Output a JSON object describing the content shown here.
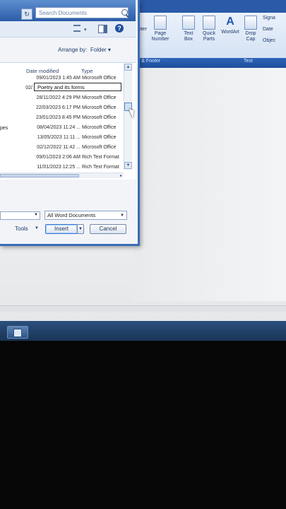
{
  "search": {
    "placeholder": "Search Documents"
  },
  "toolbar": {
    "views_caret": "▾",
    "help": "?"
  },
  "arrange": {
    "label": "Arrange by:",
    "value": "Folder ▾"
  },
  "columns": {
    "date": "Date modified",
    "type": "Type"
  },
  "side_label": "pes",
  "rename_value": "Poetry and its forms",
  "rows": [
    {
      "date": "09/01/2023 1:45 AM",
      "type": "Microsoft Office"
    },
    {
      "date": "02/",
      "type": ""
    },
    {
      "date": "28/11/2022 4:29 PM",
      "type": "Microsoft Office"
    },
    {
      "date": "22/03/2023 6:17 PM",
      "type": "Microsoft Office"
    },
    {
      "date": "23/01/2023 8:45 PM",
      "type": "Microsoft Office"
    },
    {
      "date": "08/04/2023 11:24 ...",
      "type": "Microsoft Office"
    },
    {
      "date": "13/05/2023 11:11 ...",
      "type": "Microsoft Office"
    },
    {
      "date": "02/12/2022 11:42 ...",
      "type": "Microsoft Office"
    },
    {
      "date": "09/01/2023 2:06 AM",
      "type": "Rich Text Format"
    },
    {
      "date": "11/01/2023 12:25 ...",
      "type": "Rich Text Format"
    }
  ],
  "file_type_filter": "All Word Documents",
  "buttons": {
    "tools": "Tools",
    "insert": "Insert",
    "cancel": "Cancel"
  },
  "ribbon": {
    "items": [
      {
        "label": "oter"
      },
      {
        "label": "Page Number"
      },
      {
        "label": "Text Box"
      },
      {
        "label": "Quick Parts"
      },
      {
        "label": "WordArt"
      },
      {
        "label": "Drop Cap"
      },
      {
        "label": "Signa"
      },
      {
        "label": "Date"
      },
      {
        "label": "Objec"
      }
    ],
    "groups": {
      "header_footer": "r & Footer",
      "text": "Text"
    }
  }
}
